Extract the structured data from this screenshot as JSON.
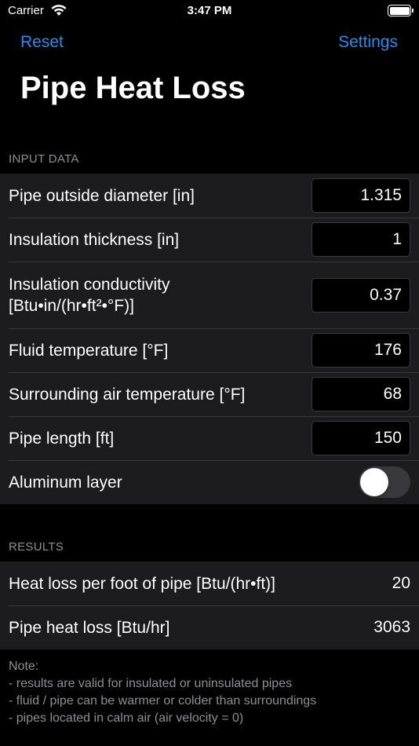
{
  "status_bar": {
    "carrier": "Carrier",
    "time": "3:47 PM"
  },
  "nav": {
    "reset_label": "Reset",
    "settings_label": "Settings"
  },
  "title": "Pipe Heat Loss",
  "input_section": {
    "header": "INPUT DATA",
    "rows": [
      {
        "label": "Pipe outside diameter [in]",
        "value": "1.315"
      },
      {
        "label": "Insulation thickness [in]",
        "value": "1"
      },
      {
        "label": "Insulation conductivity [Btu•in/(hr•ft²•°F)]",
        "value": "0.37"
      },
      {
        "label": "Fluid temperature [°F]",
        "value": "176"
      },
      {
        "label": "Surrounding air temperature [°F]",
        "value": "68"
      },
      {
        "label": "Pipe length [ft]",
        "value": "150"
      }
    ],
    "toggle": {
      "label": "Aluminum layer",
      "on": false
    }
  },
  "results_section": {
    "header": "RESULTS",
    "rows": [
      {
        "label": "Heat loss per foot of pipe [Btu/(hr•ft)]",
        "value": "20"
      },
      {
        "label": "Pipe heat loss [Btu/hr]",
        "value": "3063"
      }
    ]
  },
  "note": {
    "title": "Note:",
    "lines": [
      "- results are valid for insulated or uninsulated pipes",
      "- fluid / pipe can be warmer or colder than surroundings",
      "- pipes located in calm air (air velocity = 0)"
    ]
  },
  "colors": {
    "accent": "#1f8ef5",
    "background": "#000000",
    "cell": "#1c1c1e",
    "secondary_text": "#8e8e93"
  }
}
